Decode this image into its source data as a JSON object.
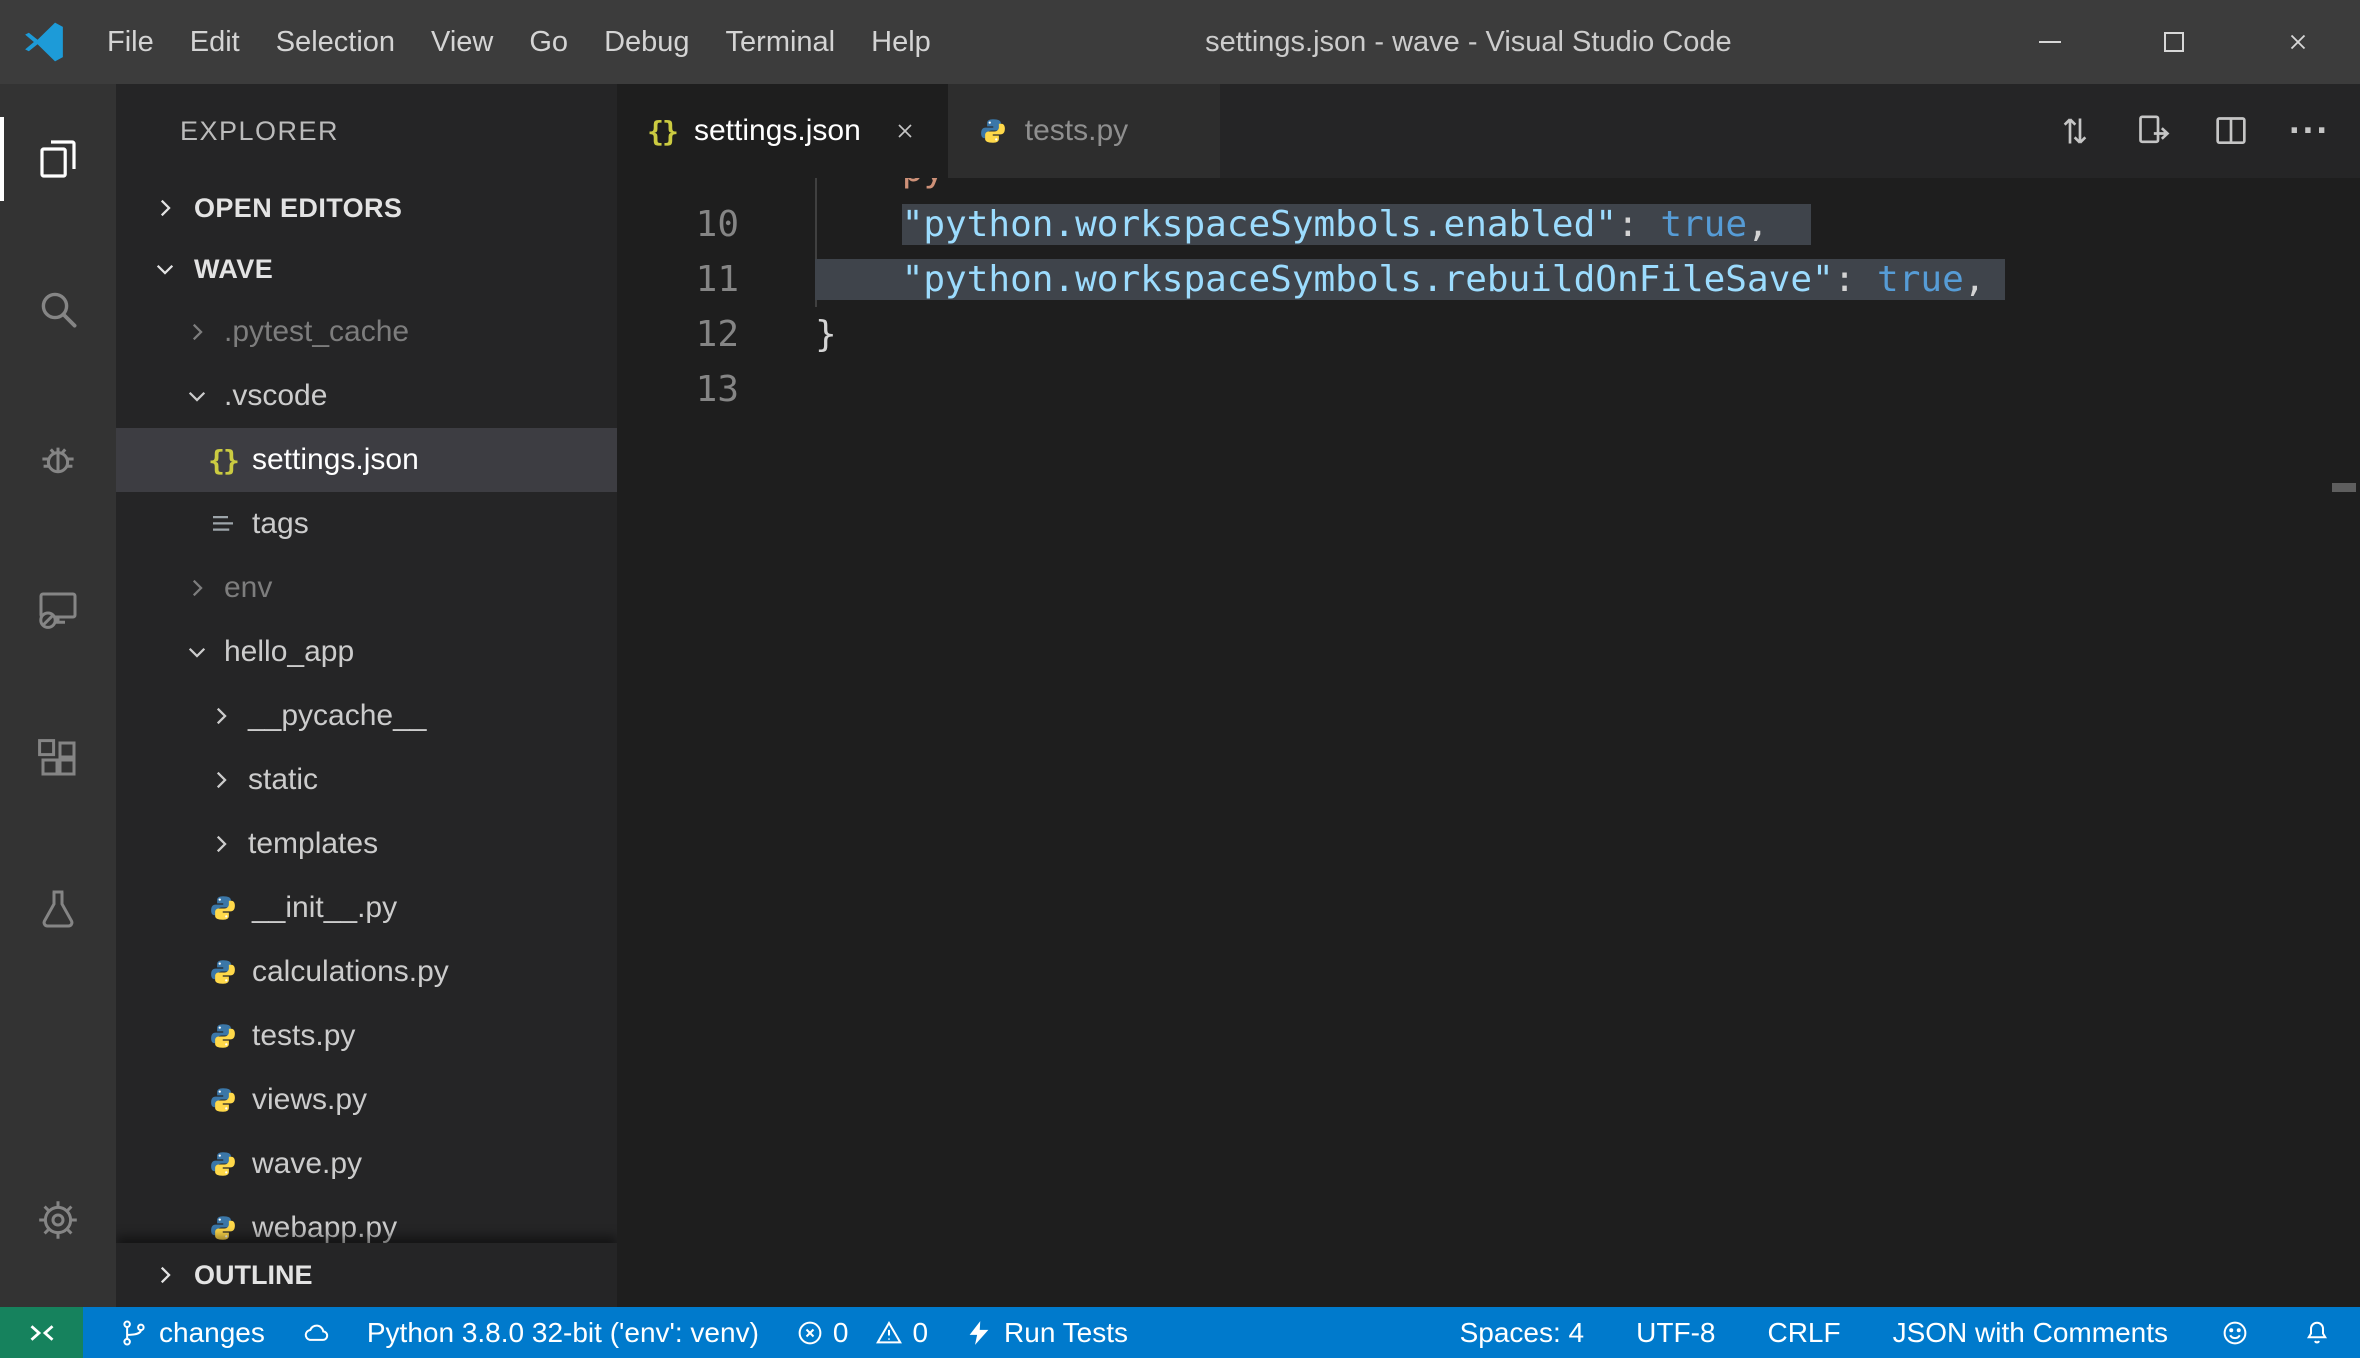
{
  "titlebar": {
    "menus": [
      "File",
      "Edit",
      "Selection",
      "View",
      "Go",
      "Debug",
      "Terminal",
      "Help"
    ],
    "title": "settings.json - wave - Visual Studio Code"
  },
  "activity_bar": {
    "items": [
      "explorer",
      "search",
      "debug",
      "remote",
      "extensions",
      "test"
    ],
    "bottom": [
      "settings"
    ]
  },
  "explorer": {
    "title": "EXPLORER",
    "open_editors_label": "OPEN EDITORS",
    "root_label": "WAVE",
    "outline_label": "OUTLINE",
    "tree": [
      {
        "label": ".pytest_cache",
        "kind": "folder",
        "state": "collapsed",
        "dimmed": true
      },
      {
        "label": ".vscode",
        "kind": "folder",
        "state": "expanded"
      },
      {
        "label": "settings.json",
        "kind": "json-file",
        "selected": true
      },
      {
        "label": "tags",
        "kind": "tags-file"
      },
      {
        "label": "env",
        "kind": "folder",
        "state": "collapsed",
        "dimmed": true
      },
      {
        "label": "hello_app",
        "kind": "folder",
        "state": "expanded"
      },
      {
        "label": "__pycache__",
        "kind": "folder",
        "state": "collapsed"
      },
      {
        "label": "static",
        "kind": "folder",
        "state": "collapsed"
      },
      {
        "label": "templates",
        "kind": "folder",
        "state": "collapsed"
      },
      {
        "label": "__init__.py",
        "kind": "python-file"
      },
      {
        "label": "calculations.py",
        "kind": "python-file"
      },
      {
        "label": "tests.py",
        "kind": "python-file"
      },
      {
        "label": "views.py",
        "kind": "python-file"
      },
      {
        "label": "wave.py",
        "kind": "python-file"
      },
      {
        "label": "webapp.py",
        "kind": "python-file",
        "clipped": true
      }
    ]
  },
  "editor": {
    "tabs": [
      {
        "label": "settings.json",
        "icon": "json",
        "active": true
      },
      {
        "label": "tests.py",
        "icon": "python",
        "active": false
      }
    ],
    "icons": {
      "json_braces": "{}",
      "more_actions": "···"
    },
    "code": {
      "l9": {
        "num": "",
        "indent": "    ",
        "fragment": "py"
      },
      "l10": {
        "num": "10",
        "indent": "    ",
        "key": "\"python.workspaceSymbols.enabled\"",
        "colon": ": ",
        "value": "true",
        "comma": ","
      },
      "l11": {
        "num": "11",
        "indent": "    ",
        "key": "\"python.workspaceSymbols.rebuildOnFileSave\"",
        "colon": ": ",
        "value": "true",
        "comma": ","
      },
      "l12": {
        "num": "12",
        "text": "}"
      },
      "l13": {
        "num": "13",
        "text": ""
      }
    }
  },
  "status_bar": {
    "branch_label": "changes",
    "python_version": "Python 3.8.0 32-bit ('env': venv)",
    "errors": "0",
    "warnings": "0",
    "run_tests_label": "Run Tests",
    "spaces": "Spaces: 4",
    "encoding": "UTF-8",
    "eol": "CRLF",
    "language": "JSON with Comments"
  },
  "colors": {
    "titlebar_bg": "#3c3c3c",
    "activitybar_bg": "#333333",
    "sidebar_bg": "#252526",
    "editor_bg": "#1e1e1e",
    "statusbar_bg": "#007acc",
    "remote_indicator_bg": "#16825d",
    "selection_bg": "#3f444b",
    "selected_row_bg": "#3d3d42",
    "json_icon_yellow": "#cbcb41",
    "json_key": "#9cdcfe",
    "json_boolean": "#569cd6",
    "json_string": "#ce9178",
    "python_icon_blue": "#3b77a8",
    "python_icon_yellow": "#ffd94a"
  }
}
